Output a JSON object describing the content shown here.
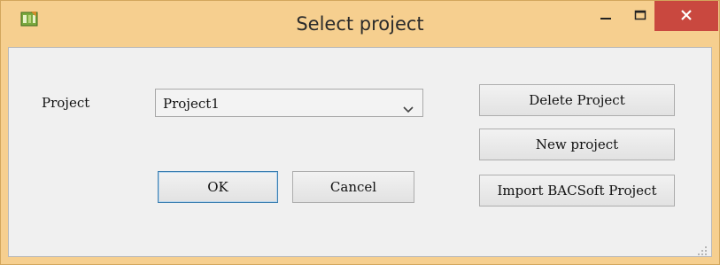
{
  "window": {
    "title": "Select project",
    "accent_color": "#f6cf8f",
    "close_color": "#c9483f",
    "icons": [
      "app-icon",
      "minimize-icon",
      "maximize-icon",
      "close-icon"
    ]
  },
  "form": {
    "project_label": "Project",
    "project_selected": "Project1",
    "ok_label": "OK",
    "cancel_label": "Cancel"
  },
  "actions": {
    "delete_label": "Delete Project",
    "new_label": "New project",
    "import_label": "Import BACSoft Project"
  }
}
